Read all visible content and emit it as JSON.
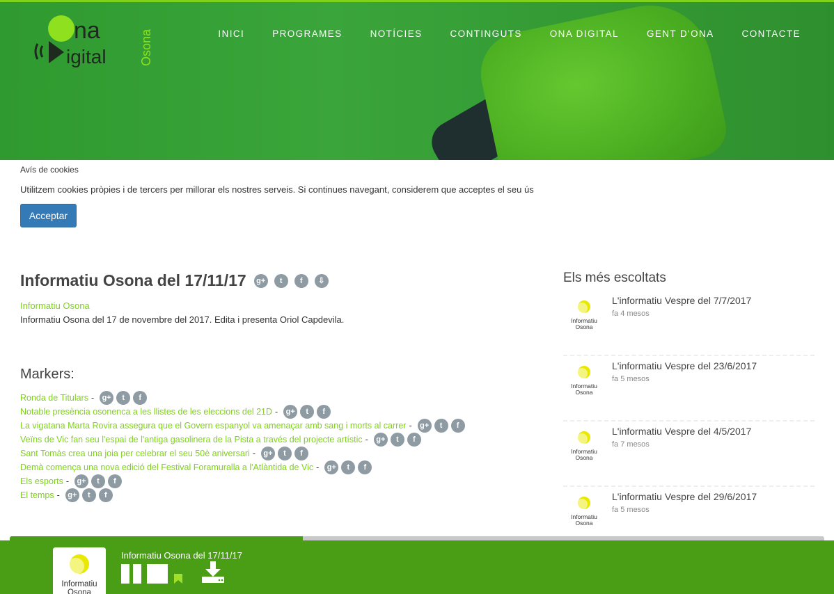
{
  "nav": {
    "items": [
      "INICI",
      "PROGRAMES",
      "NOTÍCIES",
      "CONTINGUTS",
      "ONA DIGITAL",
      "GENT D'ONA",
      "CONTACTE"
    ]
  },
  "logo": {
    "line1": "na",
    "line2": "igital",
    "region": "Osona"
  },
  "cookie": {
    "title": "Avís de cookies",
    "text": "Utilitzem cookies pròpies i de tercers per millorar els nostres serveis. Si continues navegant, considerem que acceptes el seu ús",
    "button": "Acceptar"
  },
  "episode": {
    "title": "Informatiu Osona del 17/11/17",
    "program": "Informatiu Osona",
    "description": "Informatiu Osona del 17 de novembre del 2017. Edita i presenta Oriol Capdevila.",
    "share_icons": [
      "google-plus-icon",
      "twitter-icon",
      "facebook-icon",
      "download-icon"
    ]
  },
  "markers": {
    "title": "Markers:",
    "items": [
      "Ronda de Titulars",
      "Notable presència osonenca a les llistes de les eleccions del 21D",
      "La vigatana Marta Rovira assegura que el Govern espanyol va amenaçar amb sang i morts al carrer",
      "Veïns de Vic fan seu l'espai de l'antiga gasolinera de la Pista a través del projecte artístic",
      "Sant Tomàs crea una joia per celebrar el seu 50è aniversari",
      "Demà comença una nova edició del Festival Foramuralla a l'Atlàntida de Vic",
      "Els esports",
      "El temps"
    ]
  },
  "sidebar": {
    "title": "Els més escoltats",
    "items": [
      {
        "title": "L'informatiu Vespre del 7/7/2017",
        "ago": "fa 4 mesos"
      },
      {
        "title": "L'informatiu Vespre del 23/6/2017",
        "ago": "fa 5 mesos"
      },
      {
        "title": "L'informatiu Vespre del 4/5/2017",
        "ago": "fa 7 mesos"
      },
      {
        "title": "L'informatiu Vespre del 29/6/2017",
        "ago": "fa 5 mesos"
      }
    ]
  },
  "thumb": {
    "line1": "Informatiu",
    "line2": "Osona"
  },
  "player": {
    "title": "Informatiu Osona del 17/11/17",
    "progress": 0.36
  },
  "colors": {
    "brand_green": "#7fd21a",
    "player_green": "#4a9e15",
    "button_blue": "#337ab7"
  }
}
